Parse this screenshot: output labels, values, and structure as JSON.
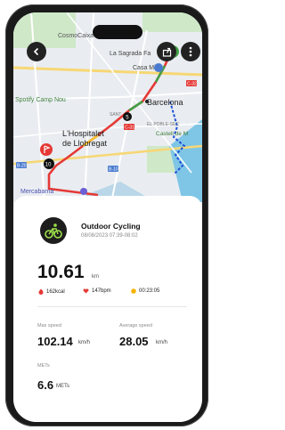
{
  "map": {
    "labels": {
      "cosmocaixa": "CosmoCaixa",
      "sagrada": "La Sagrada Fa",
      "casamila": "Casa Milà",
      "spotify": "Spotify Camp Nou",
      "barcelona": "Barcelona",
      "hospitalet1": "L'Hospitalet",
      "hospitalet2": "de Llobregat",
      "poblesec": "EL POBLE-SEC",
      "castell": "Castell de M",
      "mercabarna": "Mercabarna",
      "b20": "B-20",
      "b10": "B-10",
      "c31": "C-31",
      "c32": "C-32",
      "sant": "SANT",
      "marker5": "5",
      "marker10": "10"
    },
    "colors": {
      "route_red": "#e53935",
      "route_green": "#43a047",
      "route_yellow": "#fbc02d",
      "water": "#7fc6e6",
      "land": "#e9edf1",
      "park": "#c7e6c1"
    }
  },
  "header": {
    "back_icon": "back-arrow-icon",
    "share_icon": "share-icon",
    "more_icon": "more-vertical-icon"
  },
  "activity": {
    "icon": "cycling-icon",
    "title": "Outdoor Cycling",
    "datetime": "08/08/2023 07:39-08:02"
  },
  "summary": {
    "distance": "10.61",
    "distance_unit": "km",
    "calories": "162kcal",
    "heart_rate": "147bpm",
    "duration": "00:23:05",
    "calories_color": "#e53935",
    "heart_color": "#e53935",
    "duration_color": "#f5b400"
  },
  "metrics": {
    "max_speed_label": "Max speed",
    "max_speed_value": "102.14",
    "max_speed_unit": "km/h",
    "avg_speed_label": "Average speed",
    "avg_speed_value": "28.05",
    "avg_speed_unit": "km/h",
    "mets_label": "METs",
    "mets_value": "6.6",
    "mets_unit": "METs"
  }
}
